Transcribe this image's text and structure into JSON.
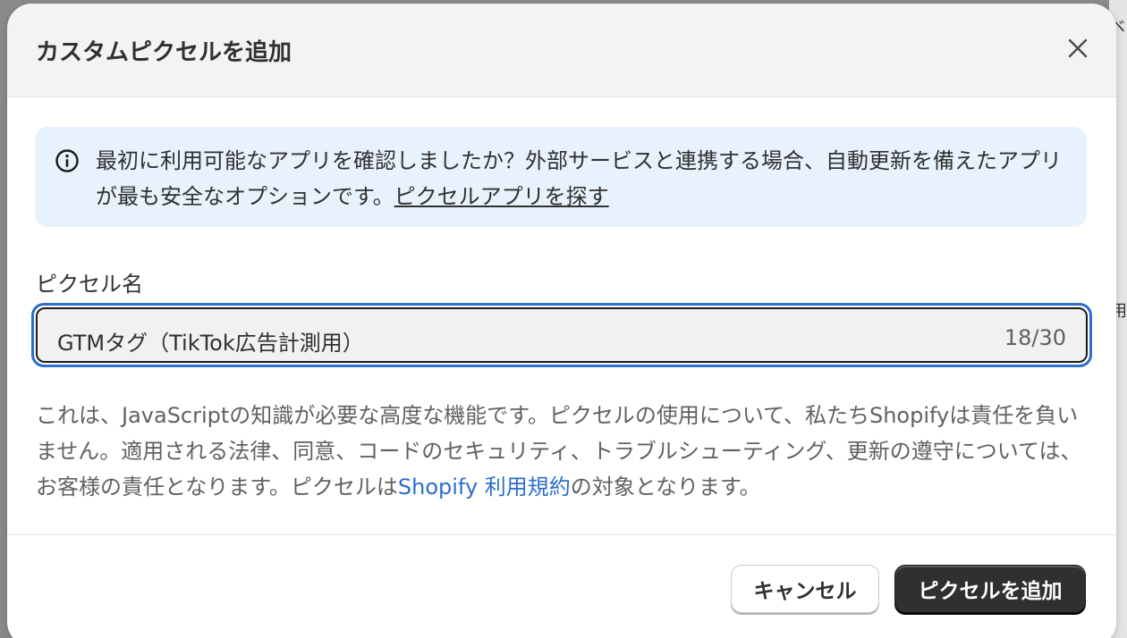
{
  "background": {
    "hint_top": "ベ",
    "hint_mid": "用"
  },
  "modal": {
    "title": "カスタムピクセルを追加",
    "close_icon": "close-icon"
  },
  "banner": {
    "icon": "info-icon",
    "text": "最初に利用可能なアプリを確認しましたか？外部サービスと連携する場合、自動更新を備えたアプリが最も安全なオプションです。",
    "link_label": "ピクセルアプリを探す",
    "background_color": "#e8f2fd"
  },
  "pixel_name_field": {
    "label": "ピクセル名",
    "value": "GTMタグ（TikTok広告計測用）",
    "counter": "18/30",
    "focus_color": "#2c6ecb"
  },
  "help": {
    "text_before": "これは、JavaScriptの知識が必要な高度な機能です。ピクセルの使用について、私たちShopifyは責任を負いません。適用される法律、同意、コードのセキュリティ、トラブルシューティング、更新の遵守については、お客様の責任となります。ピクセルは",
    "link_label": "Shopify 利用規約",
    "text_after": "の対象となります。"
  },
  "footer": {
    "cancel_label": "キャンセル",
    "primary_label": "ピクセルを追加",
    "primary_color": "#303030"
  }
}
